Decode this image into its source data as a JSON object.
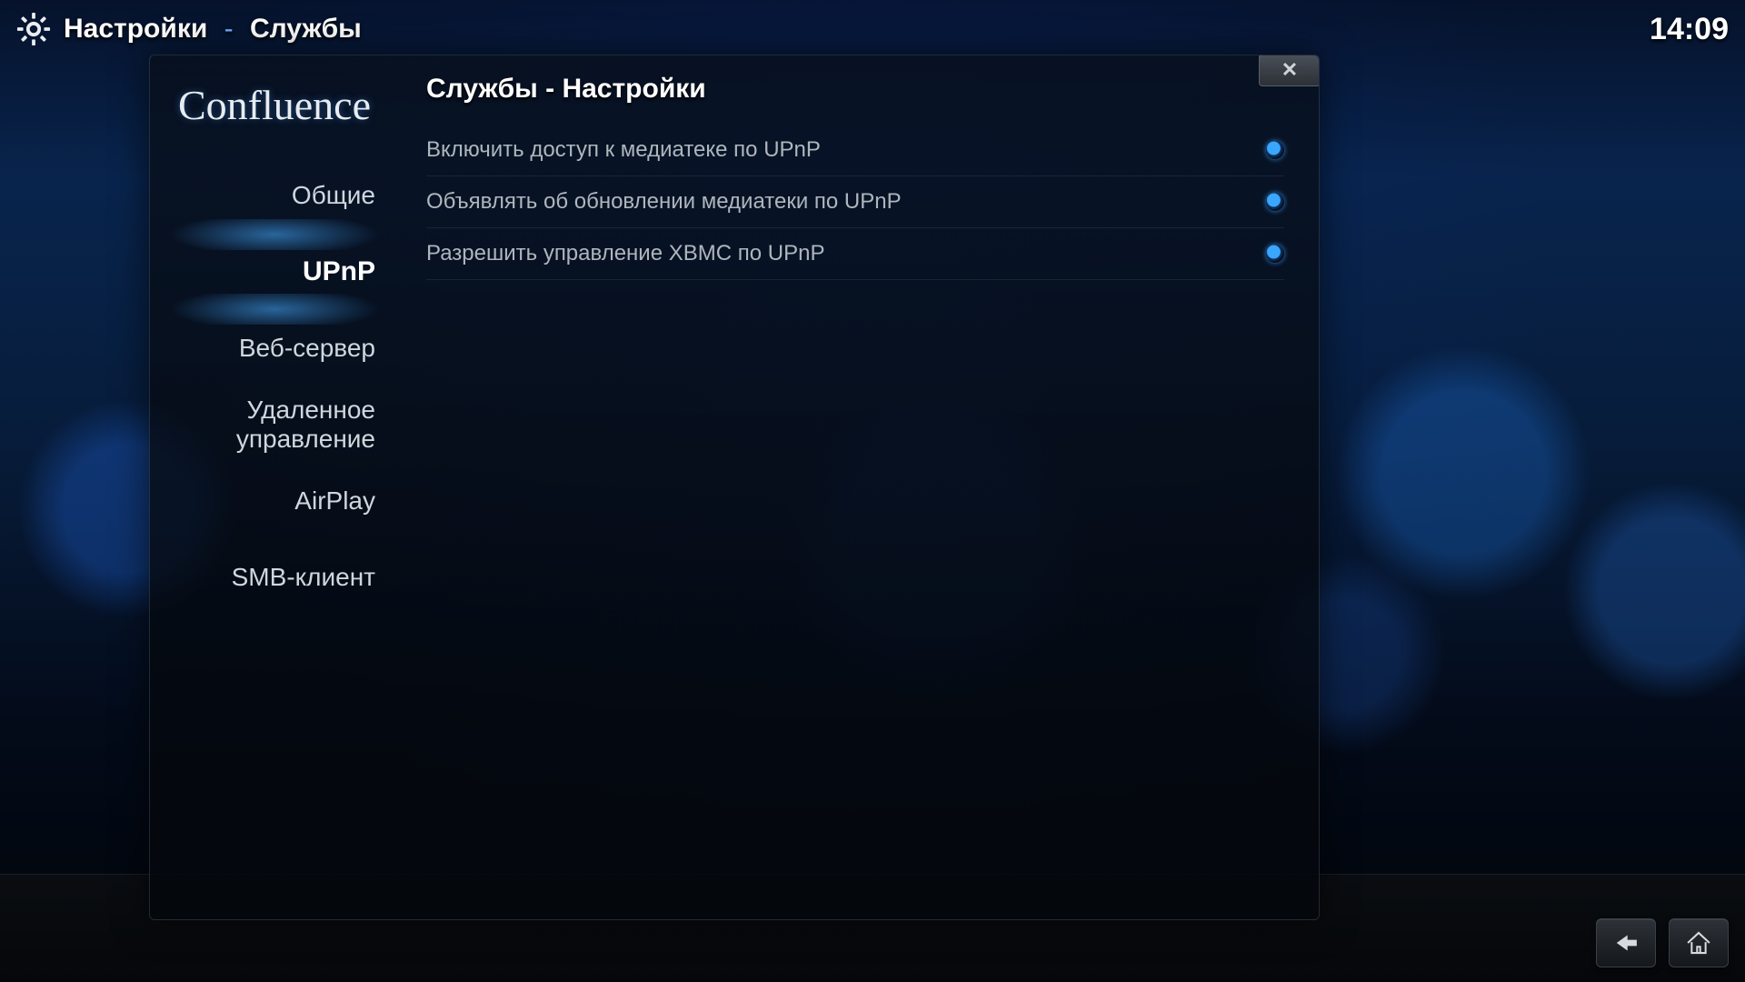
{
  "header": {
    "breadcrumb_root": "Настройки",
    "breadcrumb_separator": "-",
    "breadcrumb_current": "Службы",
    "clock": "14:09"
  },
  "sidebar": {
    "logo_text": "Confluence",
    "items": [
      {
        "label": "Общие"
      },
      {
        "label": "UPnP"
      },
      {
        "label": "Веб-сервер"
      },
      {
        "label_line1": "Удаленное",
        "label_line2": "управление"
      },
      {
        "label": "AirPlay"
      },
      {
        "label": "SMB-клиент"
      }
    ],
    "selected_index": 1
  },
  "content": {
    "title": "Службы - Настройки",
    "options": [
      {
        "label": "Включить доступ к медиатеке по UPnP",
        "enabled": true
      },
      {
        "label": "Объявлять об обновлении медиатеки по UPnP",
        "enabled": true
      },
      {
        "label": "Разрешить управление XBMC по UPnP",
        "enabled": true
      }
    ]
  },
  "buttons": {
    "close_glyph": "✕"
  }
}
